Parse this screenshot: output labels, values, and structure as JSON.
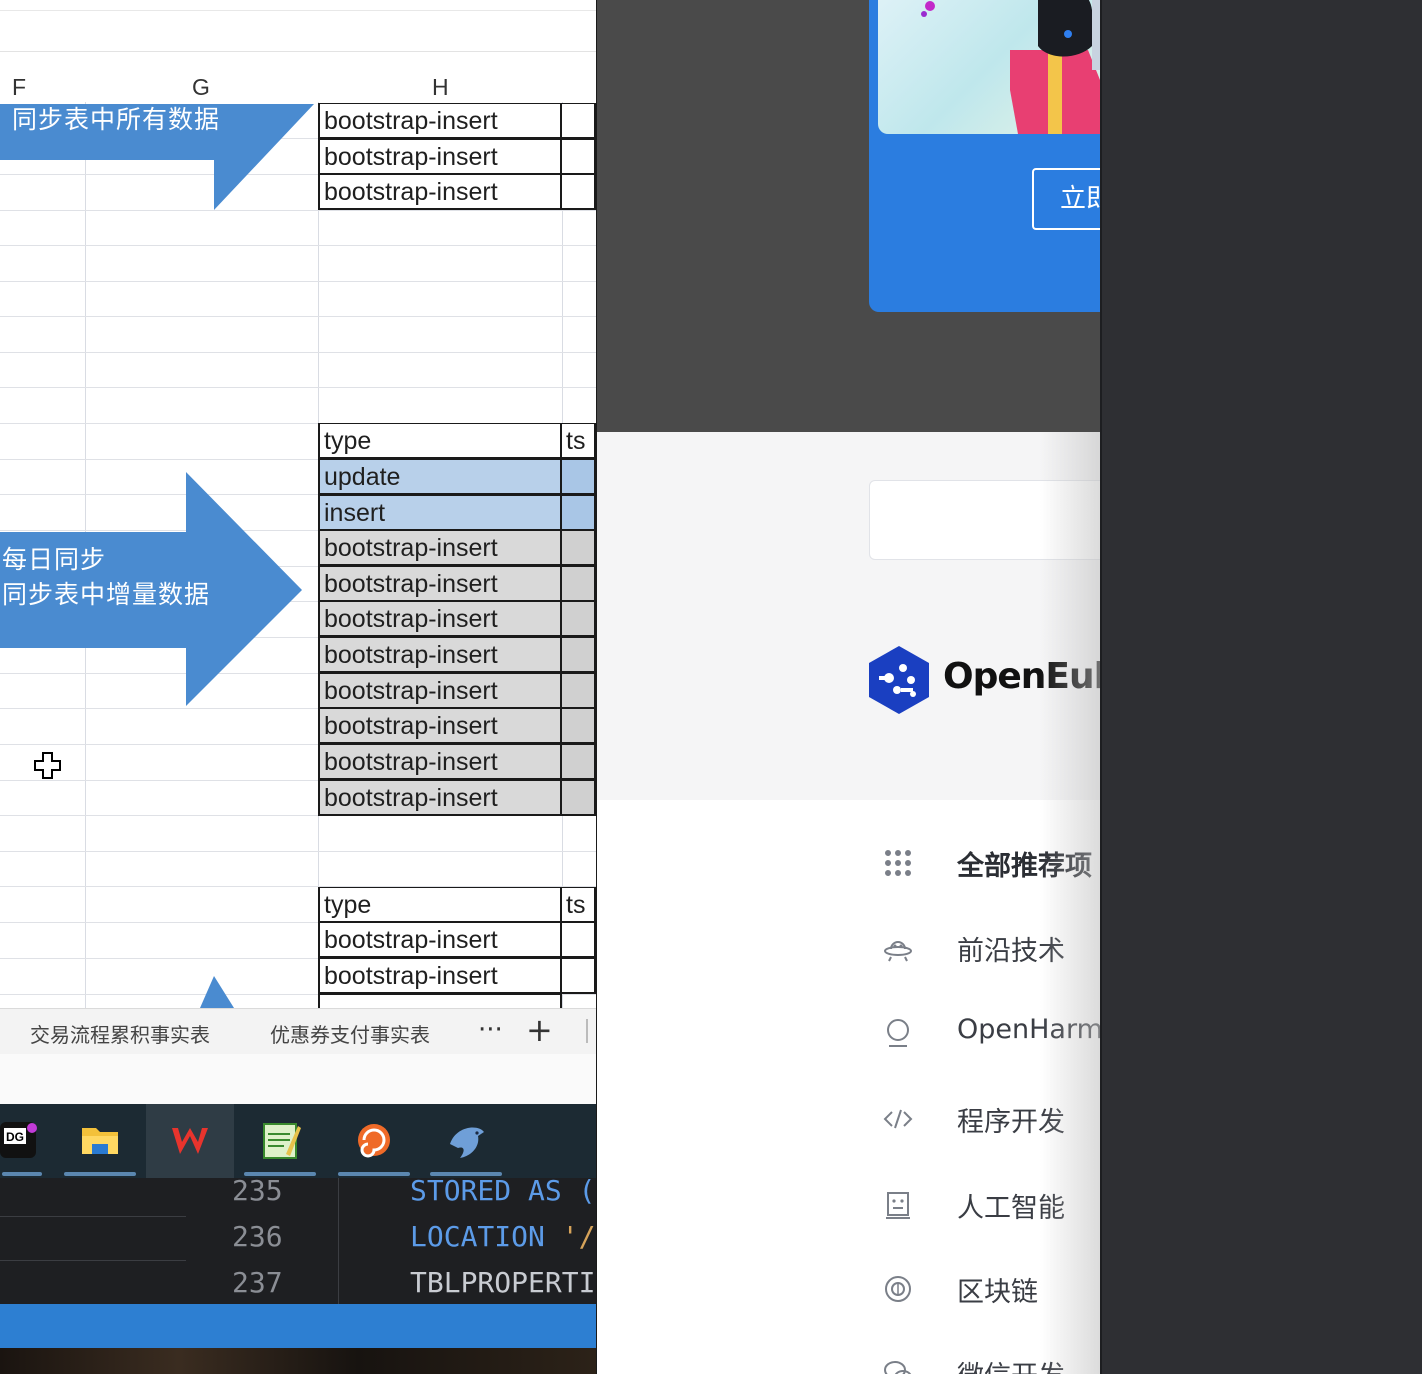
{
  "spreadsheet": {
    "columns": [
      "F",
      "G",
      "H"
    ],
    "arrow1_text": "同步表中所有数据",
    "arrow2_text_line1": "每日同步",
    "arrow2_text_line2": "同步表中增量数据",
    "table1_rows": [
      "bootstrap-insert",
      "bootstrap-insert",
      "bootstrap-insert"
    ],
    "table2_header": {
      "type": "type",
      "ts": "ts"
    },
    "table2_rows": [
      "update",
      "insert",
      "bootstrap-insert",
      "bootstrap-insert",
      "bootstrap-insert",
      "bootstrap-insert",
      "bootstrap-insert",
      "bootstrap-insert",
      "bootstrap-insert",
      "bootstrap-insert"
    ],
    "table3_header": {
      "type": "type",
      "ts": "ts"
    },
    "table3_rows": [
      "bootstrap-insert",
      "bootstrap-insert"
    ],
    "sheet_tabs": [
      "交易流程累积事实表",
      "优惠券支付事实表"
    ],
    "more_tabs": "···",
    "add_tab": "+"
  },
  "taskbar": {
    "apps": [
      "datagrip-icon",
      "file-explorer-icon",
      "wps-office-icon",
      "notepad-icon",
      "snail-icon",
      "dolphin-icon"
    ]
  },
  "editor": {
    "lines": [
      {
        "num": "235",
        "kw": "STORED AS",
        "rest": " (",
        "type": "stored"
      },
      {
        "num": "236",
        "kw": "LOCATION",
        "rest": " '/",
        "type": "location"
      },
      {
        "num": "237",
        "kw": "",
        "rest": "TBLPROPERTI",
        "type": "plain"
      }
    ]
  },
  "page": {
    "promo_button": "立即",
    "brand_name": "OpenEul",
    "categories": [
      {
        "icon": "grid-dots-icon",
        "label": "全部推荐项",
        "bold": true
      },
      {
        "icon": "ufo-icon",
        "label": "前沿技术",
        "bold": false
      },
      {
        "icon": "openharmony-icon",
        "label": "OpenHarmo",
        "bold": false
      },
      {
        "icon": "code-brackets-icon",
        "label": "程序开发",
        "bold": false
      },
      {
        "icon": "robot-icon",
        "label": "人工智能",
        "bold": false
      },
      {
        "icon": "blockchain-icon",
        "label": "区块链",
        "bold": false
      },
      {
        "icon": "wechat-icon",
        "label": "微信开发",
        "bold": false
      }
    ]
  },
  "colors": {
    "arrow_blue": "#4a8bd0",
    "cell_blue": "#b8d0ea",
    "cell_gray": "#d9d9d9",
    "promo_blue": "#2b7de0",
    "statusbar_blue": "#2d7fd2",
    "brand_blue": "#1a3fc1"
  }
}
